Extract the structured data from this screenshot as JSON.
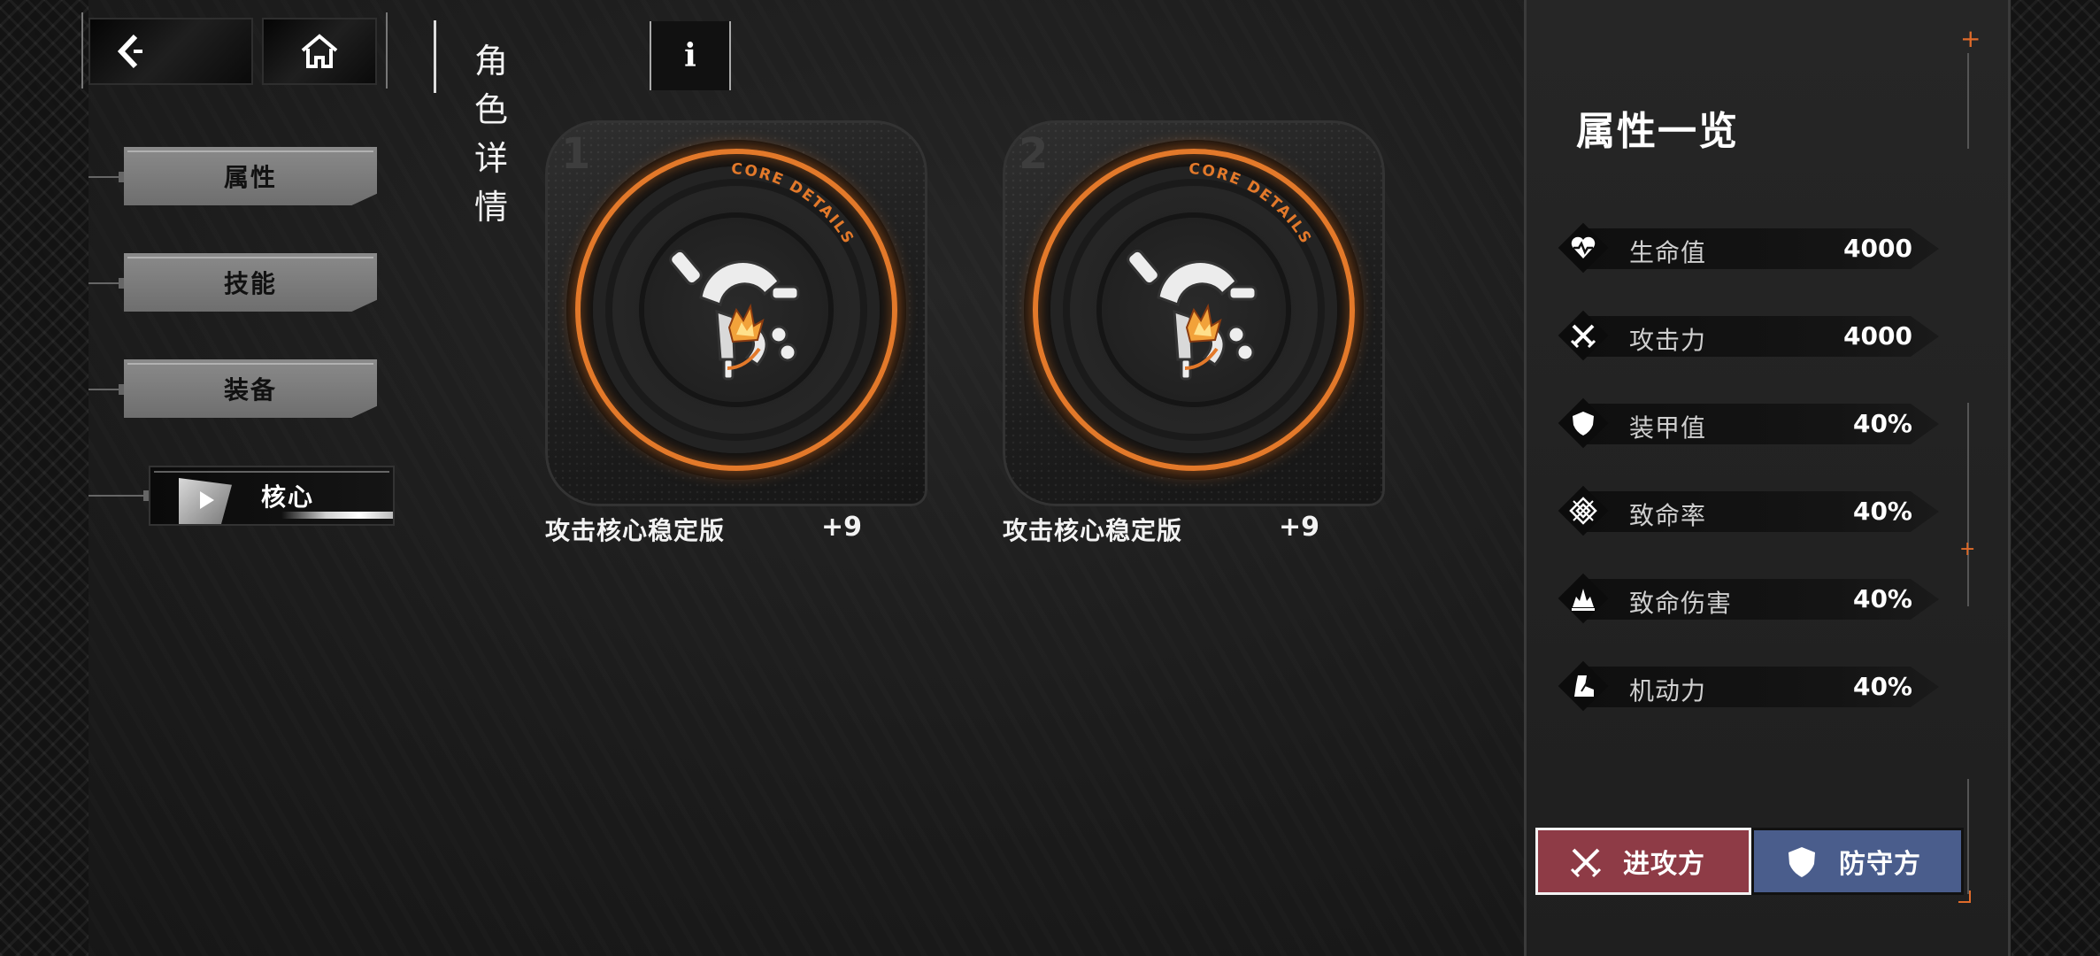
{
  "header": {
    "title": "角色详情",
    "info_label": "i",
    "back_icon": "back-arrow-icon",
    "home_icon": "home-icon"
  },
  "tabs": [
    {
      "label": "属性",
      "active": false
    },
    {
      "label": "技能",
      "active": false
    },
    {
      "label": "装备",
      "active": false
    },
    {
      "label": "核心",
      "active": true
    }
  ],
  "cores": [
    {
      "index": "1",
      "arc_text": "CORE DETAILS",
      "name": "攻击核心稳定版",
      "level": "+9",
      "icon": "attack-core-icon"
    },
    {
      "index": "2",
      "arc_text": "CORE DETAILS",
      "name": "攻击核心稳定版",
      "level": "+9",
      "icon": "attack-core-icon"
    }
  ],
  "panel": {
    "title": "属性一览",
    "stats": [
      {
        "label": "生命值",
        "value": "4000",
        "icon": "heart-pulse-icon"
      },
      {
        "label": "攻击力",
        "value": "4000",
        "icon": "crossed-swords-icon"
      },
      {
        "label": "装甲值",
        "value": "40%",
        "icon": "shield-icon"
      },
      {
        "label": "致命率",
        "value": "40%",
        "icon": "crit-pattern-icon"
      },
      {
        "label": "致命伤害",
        "value": "40%",
        "icon": "explosion-icon"
      },
      {
        "label": "机动力",
        "value": "40%",
        "icon": "boot-icon"
      }
    ],
    "attack_button": "进攻方",
    "defense_button": "防守方"
  },
  "colors": {
    "accent_orange": "#e3792a",
    "attack_red": "#8e3b46",
    "defense_blue": "#4a5d8c"
  }
}
